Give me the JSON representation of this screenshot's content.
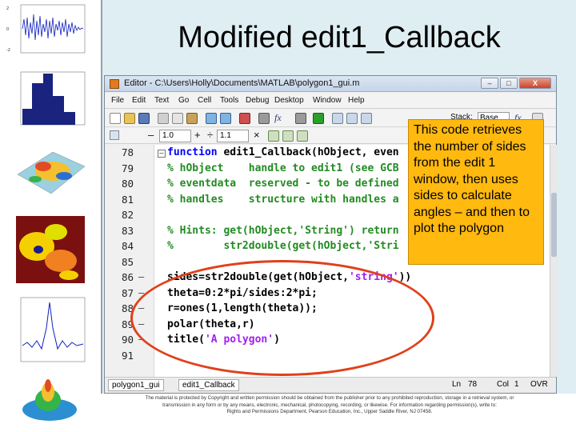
{
  "slide": {
    "title": "Modified edit1_Callback",
    "callout": "This code retrieves the number of sides from the edit 1 window, then uses sides to calculate angles – and then to plot the polygon",
    "footer": [
      "The material is protected by Copyright and written permission should be obtained from the publisher prior to any prohibited reproduction, storage in a retrieval system, or",
      "transmission in any form or by any means, electronic, mechanical, photocopying, recording, or likewise. For information regarding permission(s), write to:",
      "Rights and Permissions Department, Pearson Education, Inc., Upper Saddle River, NJ 07458."
    ]
  },
  "editor": {
    "title": "Editor - C:\\Users\\Holly\\Documents\\MATLAB\\polygon1_gui.m",
    "window_buttons": {
      "min": "–",
      "max": "□",
      "close": "X"
    },
    "menu": [
      "File",
      "Edit",
      "Text",
      "Go",
      "Cell",
      "Tools",
      "Debug",
      "Desktop",
      "Window",
      "Help"
    ],
    "toolbar": {
      "stack_label": "Stack:",
      "stack_value": "Base",
      "fx_label": "fx"
    },
    "cell_toolbar": {
      "minus": "–",
      "value1": "1.0",
      "plus": "+",
      "divide": "÷",
      "value2": "1.1",
      "times": "×"
    },
    "lines": [
      {
        "num": "78",
        "dash": "",
        "fold": "–",
        "segments": [
          [
            "kw",
            "function "
          ],
          [
            "tx",
            "edit1_Callback(hObject, even"
          ]
        ]
      },
      {
        "num": "79",
        "dash": "",
        "fold": "",
        "segments": [
          [
            "cm",
            "% hObject    handle to edit1 (see GCB"
          ]
        ]
      },
      {
        "num": "80",
        "dash": "",
        "fold": "",
        "segments": [
          [
            "cm",
            "% eventdata  reserved - to be defined"
          ]
        ]
      },
      {
        "num": "81",
        "dash": "",
        "fold": "",
        "segments": [
          [
            "cm",
            "% handles    structure with handles a"
          ]
        ]
      },
      {
        "num": "82",
        "dash": "",
        "fold": "",
        "segments": [
          [
            "tx",
            ""
          ]
        ]
      },
      {
        "num": "83",
        "dash": "",
        "fold": "",
        "segments": [
          [
            "cm",
            "% Hints: get(hObject,'String') return"
          ]
        ]
      },
      {
        "num": "84",
        "dash": "",
        "fold": "",
        "segments": [
          [
            "cm",
            "%        str2double(get(hObject,'Stri"
          ]
        ]
      },
      {
        "num": "85",
        "dash": "",
        "fold": "",
        "segments": [
          [
            "tx",
            ""
          ]
        ]
      },
      {
        "num": "86",
        "dash": "–",
        "fold": "",
        "segments": [
          [
            "tx",
            "sides=str2double(get(hObject,"
          ],
          [
            "st",
            "'string'"
          ],
          [
            "tx",
            "))"
          ]
        ]
      },
      {
        "num": "87",
        "dash": "–",
        "fold": "",
        "segments": [
          [
            "tx",
            "theta=0:2*pi/sides:2*pi;"
          ]
        ]
      },
      {
        "num": "88",
        "dash": "–",
        "fold": "",
        "segments": [
          [
            "tx",
            "r=ones(1,length(theta));"
          ]
        ]
      },
      {
        "num": "89",
        "dash": "–",
        "fold": "",
        "segments": [
          [
            "tx",
            "polar(theta,r)"
          ]
        ]
      },
      {
        "num": "90",
        "dash": "–",
        "fold": "",
        "segments": [
          [
            "tx",
            "title("
          ],
          [
            "st",
            "'A polygon'"
          ],
          [
            "tx",
            ")"
          ]
        ]
      },
      {
        "num": "91",
        "dash": "",
        "fold": "",
        "segments": [
          [
            "tx",
            ""
          ]
        ]
      }
    ],
    "status": {
      "tab": "polygon1_gui",
      "function": "edit1_Callback",
      "ln_label": "Ln",
      "ln_value": "78",
      "col_label": "Col",
      "col_value": "1",
      "mode": "OVR"
    }
  },
  "colors": {
    "callout_bg": "#ffb90f",
    "highlight": "#e0401a",
    "keyword": "#0000ff",
    "comment": "#228b22",
    "string": "#a020f0",
    "slide_bg": "#dfeef3"
  }
}
